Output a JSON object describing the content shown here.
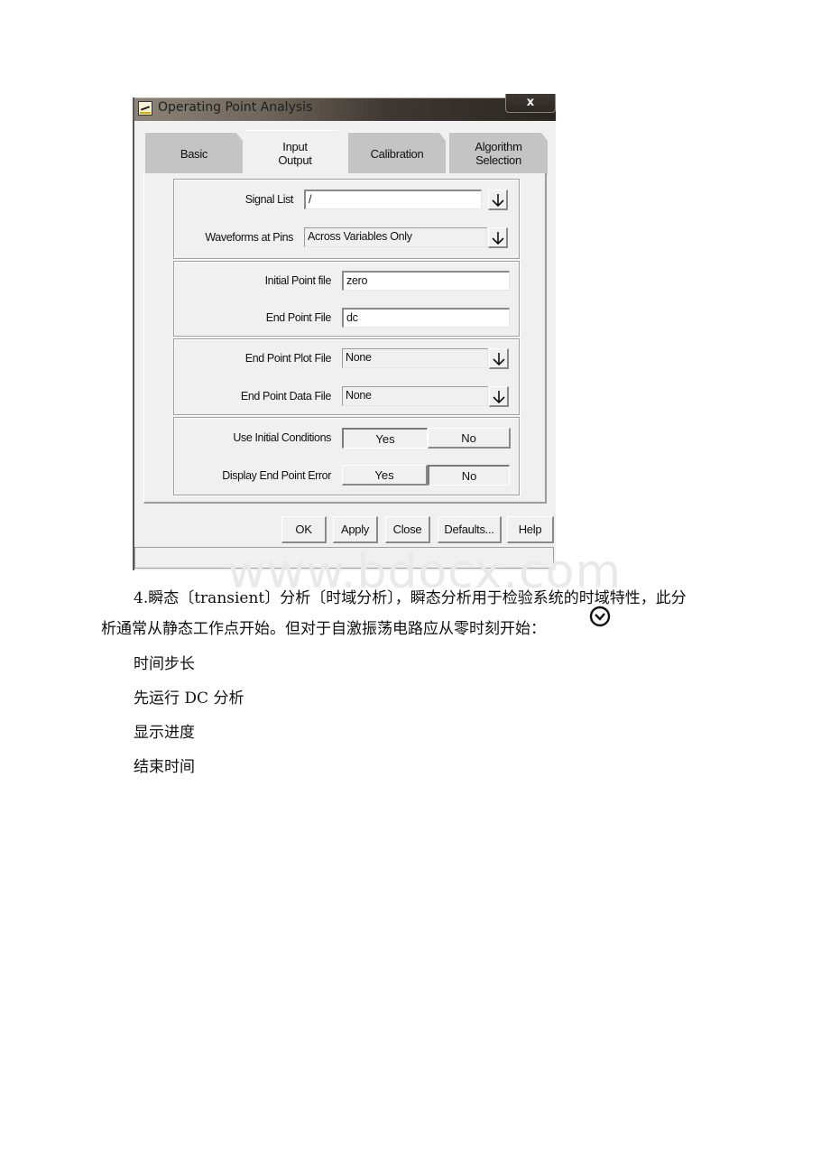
{
  "dialog": {
    "title": "Operating Point Analysis",
    "close_glyph": "x",
    "tabs": [
      {
        "line1": "Basic",
        "line2": ""
      },
      {
        "line1": "Input",
        "line2": "Output"
      },
      {
        "line1": "Calibration",
        "line2": ""
      },
      {
        "line1": "Algorithm",
        "line2": "Selection"
      }
    ],
    "active_tab": "Input Output",
    "fields": {
      "signal_list": {
        "label": "Signal List",
        "value": "/"
      },
      "waveforms_at_pins": {
        "label": "Waveforms at Pins",
        "value": "Across Variables Only"
      },
      "initial_point_file": {
        "label": "Initial Point file",
        "value": "zero"
      },
      "end_point_file": {
        "label": "End Point File",
        "value": "dc"
      },
      "end_point_plot_file": {
        "label": "End Point Plot File",
        "value": "None"
      },
      "end_point_data_file": {
        "label": "End Point Data File",
        "value": "None"
      },
      "use_initial_conditions": {
        "label": "Use Initial Conditions",
        "yes": "Yes",
        "no": "No",
        "selected": "Yes"
      },
      "display_end_point_error": {
        "label": "Display End Point Error",
        "yes": "Yes",
        "no": "No",
        "selected": "No"
      }
    },
    "buttons": {
      "ok": "OK",
      "apply": "Apply",
      "close": "Close",
      "defaults": "Defaults...",
      "help": "Help"
    }
  },
  "watermark": "www.bdocx.com",
  "document": {
    "paragraph_line1": "4.瞬态〔transient〕分析〔时域分析〕，瞬态分析用于检验系统的时域特性，此分",
    "paragraph_line2": "析通常从静态工作点开始。但对于自激振荡电路应从零时刻开始：",
    "items": [
      "时间步长",
      "先运行 DC 分析",
      "显示进度",
      "结束时间"
    ]
  }
}
